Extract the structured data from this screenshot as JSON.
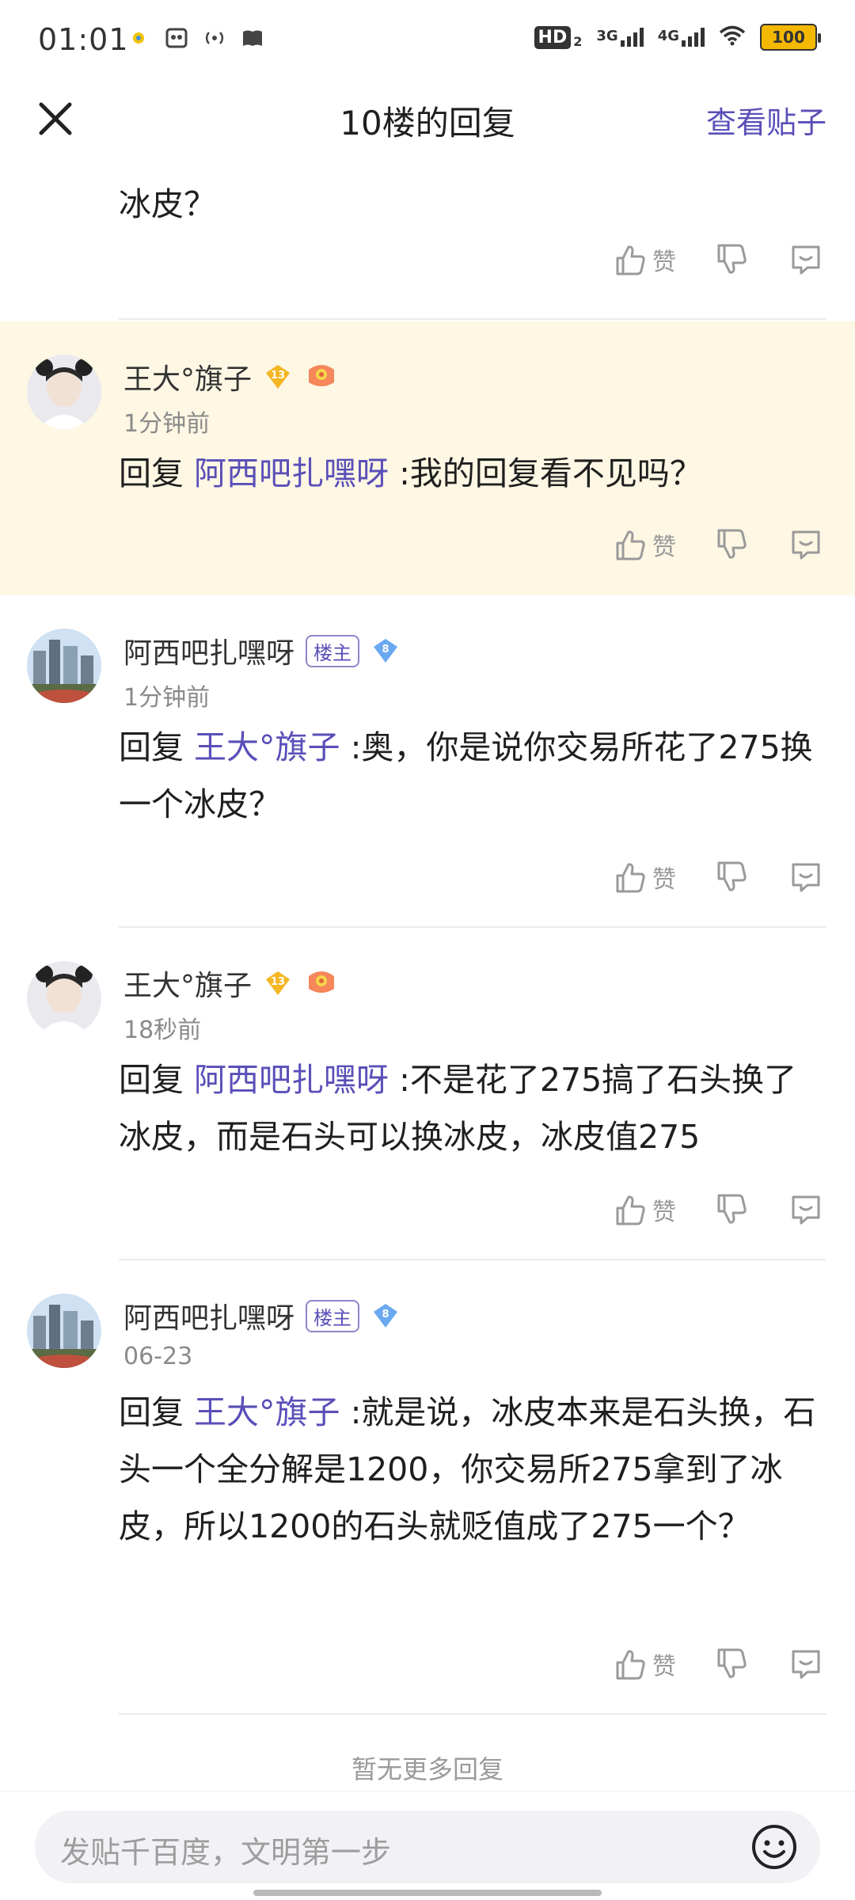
{
  "status_bar": {
    "time": "01:01",
    "hd": "HD",
    "hd_sub": "2",
    "net1": "3G",
    "net2": "4G",
    "battery": "100"
  },
  "header": {
    "title": "10楼的回复",
    "view_post": "查看贴子"
  },
  "top_fragment": {
    "text": "冰皮？"
  },
  "actions": {
    "like_label": "赞"
  },
  "replies": [
    {
      "username": "王大°旗子",
      "level": "13",
      "time": "1分钟前",
      "prefix": "回复",
      "mention": "阿西吧扎嘿呀",
      "body": " :我的回复看不见吗？"
    },
    {
      "username": "阿西吧扎嘿呀",
      "badge": "楼主",
      "level": "8",
      "time": "1分钟前",
      "prefix": "回复",
      "mention": "王大°旗子",
      "body": " :奥，你是说你交易所花了275换一个冰皮？"
    },
    {
      "username": "王大°旗子",
      "level": "13",
      "time": "18秒前",
      "prefix": "回复",
      "mention": "阿西吧扎嘿呀",
      "body": " :不是花了275搞了石头换了冰皮，而是石头可以换冰皮，冰皮值275"
    },
    {
      "username": "阿西吧扎嘿呀",
      "badge": "楼主",
      "level": "8",
      "time": "06-23",
      "prefix": "回复",
      "mention": "王大°旗子",
      "body": " :就是说，冰皮本来是石头换，石头一个全分解是1200，你交易所275拿到了冰皮，所以1200的石头就贬值成了275一个？"
    }
  ],
  "footer": {
    "no_more": "暂无更多回复",
    "input_placeholder": "发贴千百度，文明第一步"
  },
  "colors": {
    "accent": "#5a4fb8",
    "highlight_bg": "#fdf7e4",
    "muted": "#9a9a9a"
  }
}
